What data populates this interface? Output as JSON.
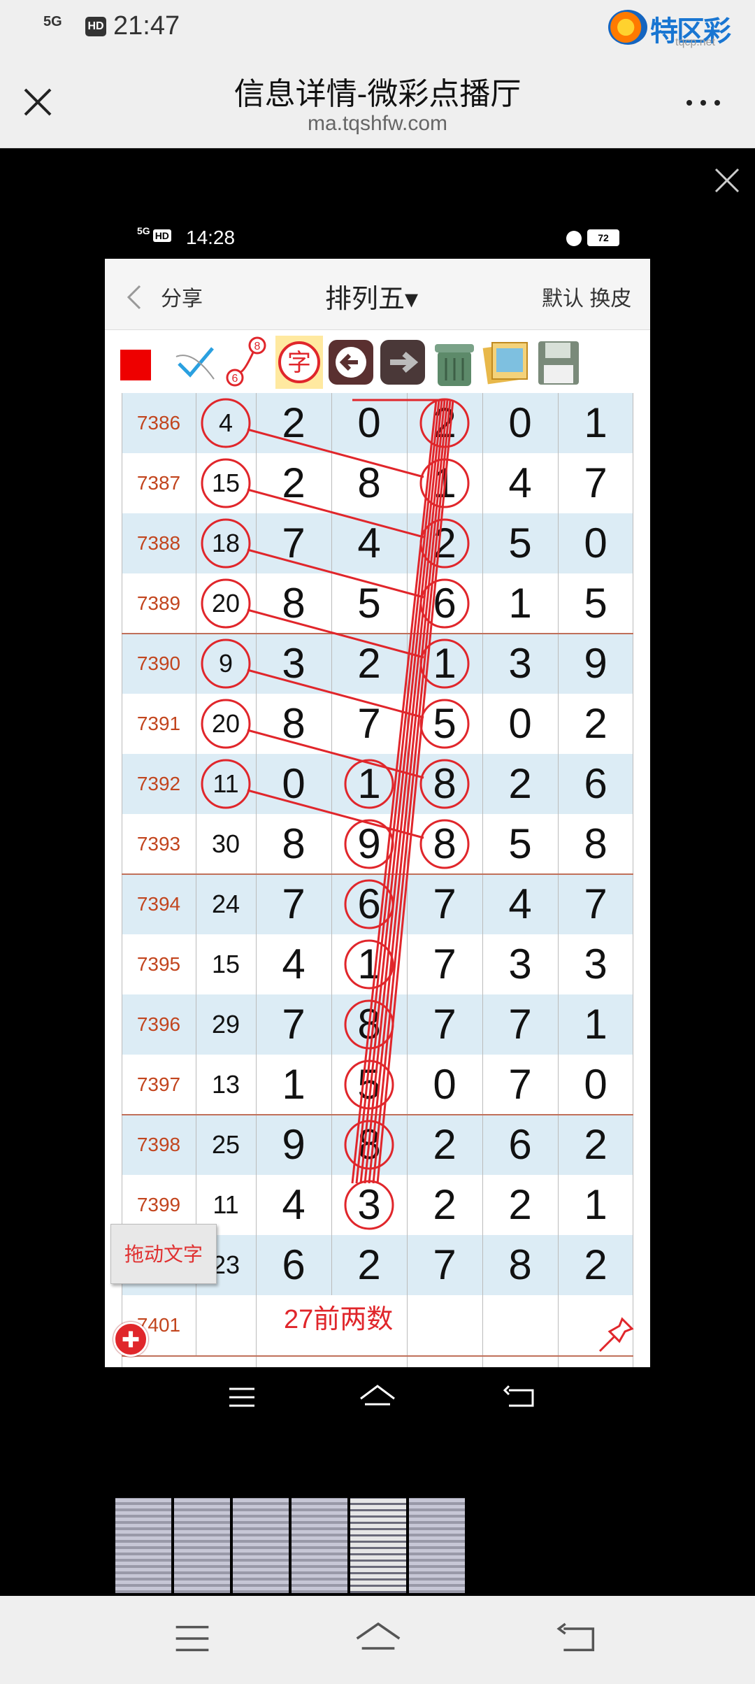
{
  "outer_status": {
    "network": "5G",
    "hd": "HD",
    "time": "21:47"
  },
  "watermark": {
    "text": "特区彩票网",
    "sub": "tqcp.net"
  },
  "browser": {
    "title": "信息详情-微彩点播厅",
    "url": "ma.tqshfw.com"
  },
  "inner_status": {
    "network": "5G",
    "hd": "HD",
    "time": "14:28",
    "battery": "72"
  },
  "app": {
    "share": "分享",
    "title": "排列五▾",
    "skin": "默认 换皮",
    "toolbar_icons": [
      "red-square-icon",
      "checkmark-pen-icon",
      "link-68-icon",
      "zi-character-icon",
      "back-arrow-icon",
      "forward-arrow-icon",
      "trash-can-icon",
      "pictures-icon",
      "save-disk-icon"
    ],
    "toolbar_badges": {
      "top": "8",
      "bottom": "6",
      "zi": "字"
    },
    "rows": [
      {
        "issue": "7386",
        "sum": "4",
        "digits": [
          "2",
          "0",
          "2",
          "0",
          "1"
        ]
      },
      {
        "issue": "7387",
        "sum": "15",
        "digits": [
          "2",
          "8",
          "1",
          "4",
          "7"
        ]
      },
      {
        "issue": "7388",
        "sum": "18",
        "digits": [
          "7",
          "4",
          "2",
          "5",
          "0"
        ]
      },
      {
        "issue": "7389",
        "sum": "20",
        "digits": [
          "8",
          "5",
          "6",
          "1",
          "5"
        ]
      },
      {
        "issue": "7390",
        "sum": "9",
        "digits": [
          "3",
          "2",
          "1",
          "3",
          "9"
        ]
      },
      {
        "issue": "7391",
        "sum": "20",
        "digits": [
          "8",
          "7",
          "5",
          "0",
          "2"
        ]
      },
      {
        "issue": "7392",
        "sum": "11",
        "digits": [
          "0",
          "1",
          "8",
          "2",
          "6"
        ]
      },
      {
        "issue": "7393",
        "sum": "30",
        "digits": [
          "8",
          "9",
          "8",
          "5",
          "8"
        ]
      },
      {
        "issue": "7394",
        "sum": "24",
        "digits": [
          "7",
          "6",
          "7",
          "4",
          "7"
        ]
      },
      {
        "issue": "7395",
        "sum": "15",
        "digits": [
          "4",
          "1",
          "7",
          "3",
          "3"
        ]
      },
      {
        "issue": "7396",
        "sum": "29",
        "digits": [
          "7",
          "8",
          "7",
          "7",
          "1"
        ]
      },
      {
        "issue": "7397",
        "sum": "13",
        "digits": [
          "1",
          "5",
          "0",
          "7",
          "0"
        ]
      },
      {
        "issue": "7398",
        "sum": "25",
        "digits": [
          "9",
          "8",
          "2",
          "6",
          "2"
        ]
      },
      {
        "issue": "7399",
        "sum": "11",
        "digits": [
          "4",
          "3",
          "2",
          "2",
          "1"
        ]
      },
      {
        "issue": "",
        "sum": "23",
        "digits": [
          "6",
          "2",
          "7",
          "8",
          "2"
        ]
      }
    ],
    "last_issue": "7401",
    "drag_text": "拖动文字",
    "note": "27前两数"
  },
  "colors": {
    "accent_red": "#e0262b",
    "issue_orange": "#c2451e",
    "row_blue": "#dcecf5"
  }
}
